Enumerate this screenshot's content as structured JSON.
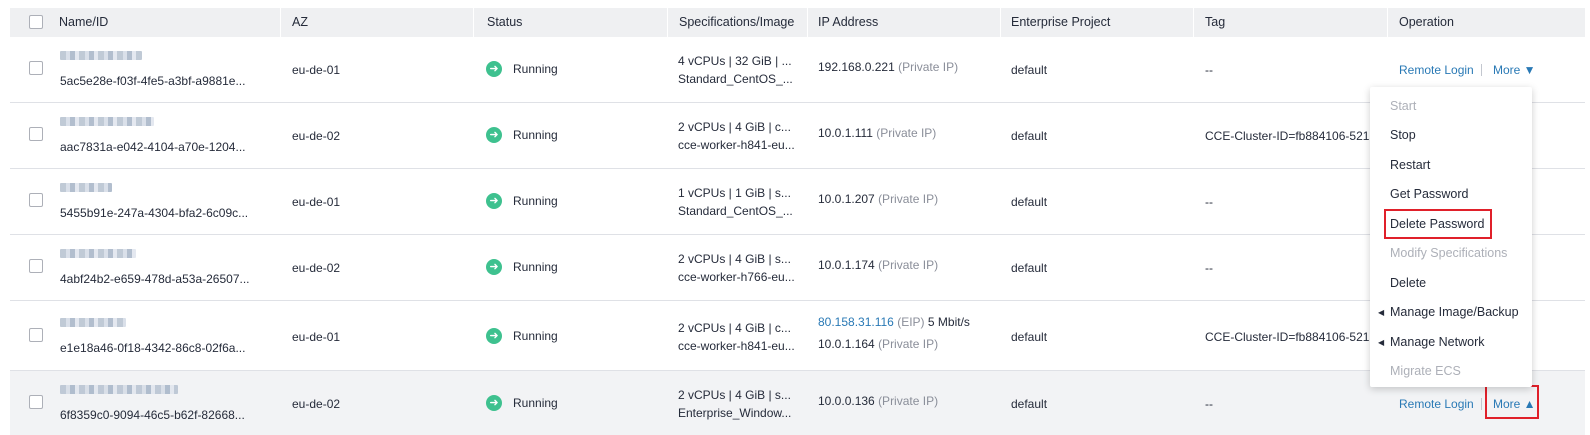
{
  "columns": [
    "Name/ID",
    "AZ",
    "Status",
    "Specifications/Image",
    "IP Address",
    "Enterprise Project",
    "Tag",
    "Operation"
  ],
  "rows": [
    {
      "id": "5ac5e28e-f03f-4fe5-a3bf-a9881e...",
      "az": "eu-de-01",
      "status": "Running",
      "spec1": "4 vCPUs | 32 GiB | ...",
      "spec2": "Standard_CentOS_...",
      "ip1": "192.168.0.221",
      "ip1_type": "(Private IP)",
      "project": "default",
      "tag": "--"
    },
    {
      "id": "aac7831a-e042-4104-a70e-1204...",
      "az": "eu-de-02",
      "status": "Running",
      "spec1": "2 vCPUs | 4 GiB | c...",
      "spec2": "cce-worker-h841-eu...",
      "ip1": "10.0.1.111",
      "ip1_type": "(Private IP)",
      "project": "default",
      "tag": "CCE-Cluster-ID=fb884106-521..."
    },
    {
      "id": "5455b91e-247a-4304-bfa2-6c09c...",
      "az": "eu-de-01",
      "status": "Running",
      "spec1": "1 vCPUs | 1 GiB | s...",
      "spec2": "Standard_CentOS_...",
      "ip1": "10.0.1.207",
      "ip1_type": "(Private IP)",
      "project": "default",
      "tag": "--"
    },
    {
      "id": "4abf24b2-e659-478d-a53a-26507...",
      "az": "eu-de-02",
      "status": "Running",
      "spec1": "2 vCPUs | 4 GiB | s...",
      "spec2": "cce-worker-h766-eu...",
      "ip1": "10.0.1.174",
      "ip1_type": "(Private IP)",
      "project": "default",
      "tag": "--"
    },
    {
      "id": "e1e18a46-0f18-4342-86c8-02f6a...",
      "az": "eu-de-01",
      "status": "Running",
      "spec1": "2 vCPUs | 4 GiB | c...",
      "spec2": "cce-worker-h841-eu...",
      "ip1": "80.158.31.116",
      "ip1_type": "(EIP)",
      "ip1_extra": "5 Mbit/s",
      "ip2": "10.0.1.164",
      "ip2_type": "(Private IP)",
      "project": "default",
      "tag": "CCE-Cluster-ID=fb884106-521..."
    },
    {
      "id": "6f8359c0-9094-46c5-b62f-82668...",
      "az": "eu-de-02",
      "status": "Running",
      "spec1": "2 vCPUs | 4 GiB | s...",
      "spec2": "Enterprise_Window...",
      "ip1": "10.0.0.136",
      "ip1_type": "(Private IP)",
      "project": "default",
      "tag": "--"
    }
  ],
  "operation": {
    "remote_login": "Remote Login",
    "more_down": "More ▼",
    "more_up": "More ▲"
  },
  "menu": [
    "Start",
    "Stop",
    "Restart",
    "Get Password",
    "Delete Password",
    "Modify Specifications",
    "Delete",
    "Manage Image/Backup",
    "Manage Network",
    "Migrate ECS"
  ],
  "colors": {
    "status_running": "#3ec18f",
    "link": "#2979b5",
    "highlight_box": "#e0202a"
  }
}
